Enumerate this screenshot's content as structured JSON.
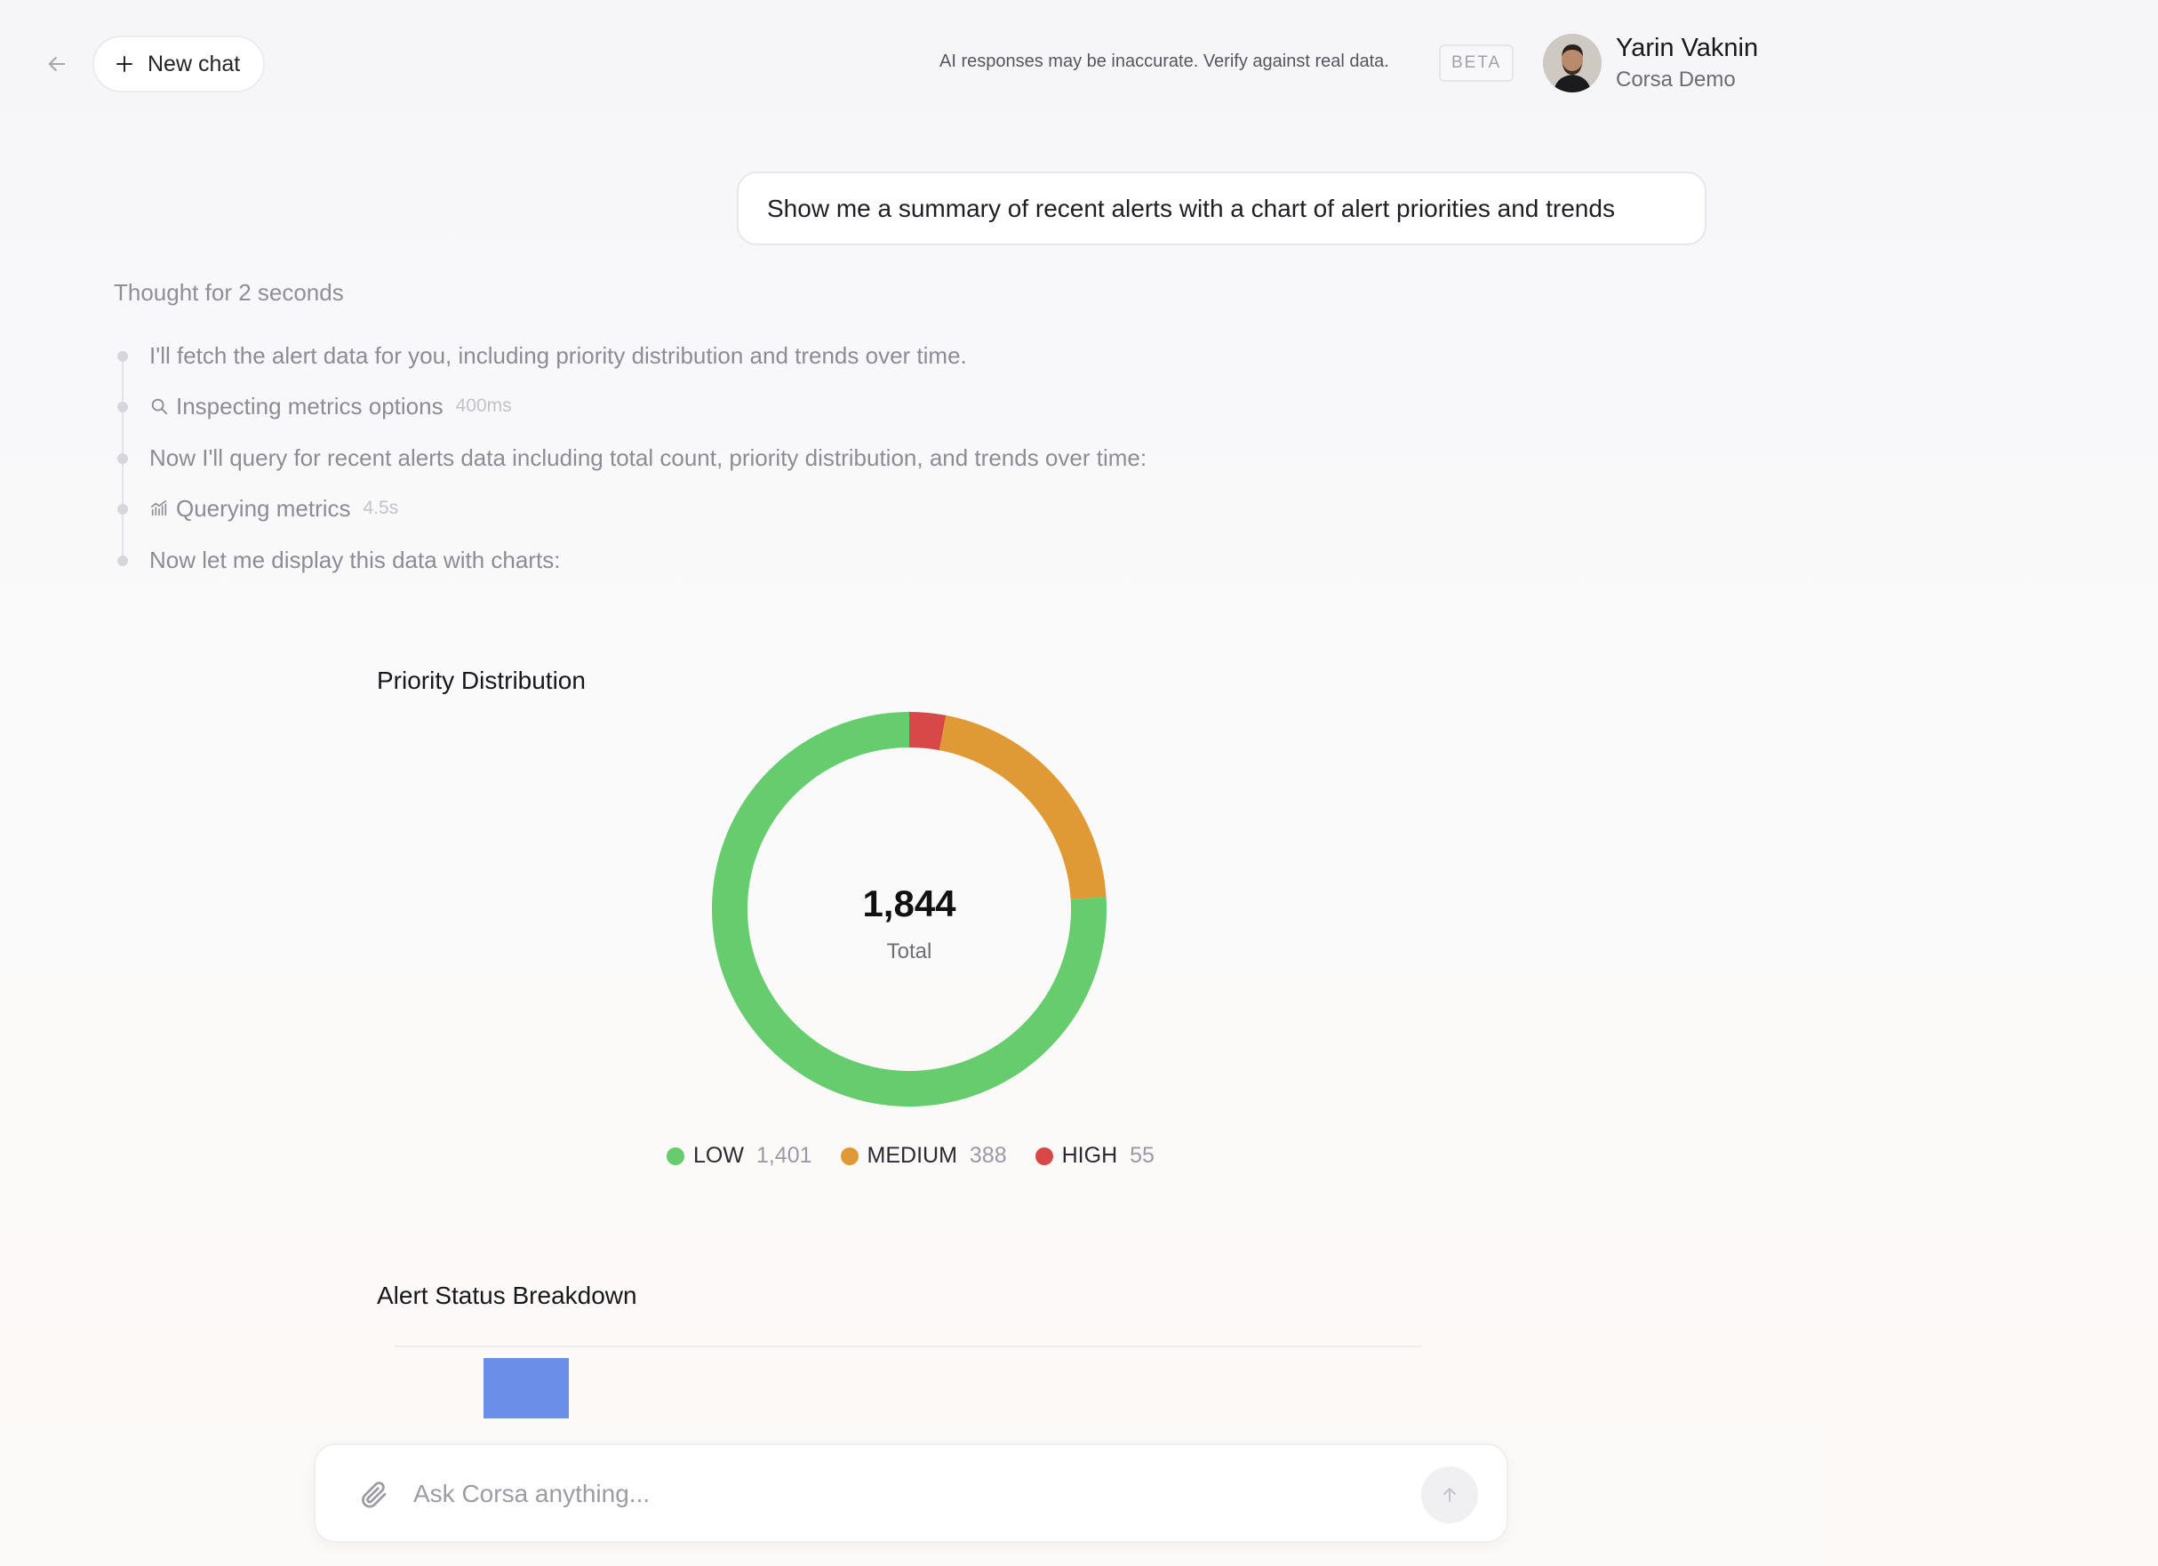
{
  "header": {
    "new_chat_label": "New chat",
    "disclaimer": "AI responses may be inaccurate. Verify against real data.",
    "beta_badge": "BETA",
    "user_name": "Yarin Vaknin",
    "user_org": "Corsa Demo"
  },
  "conversation": {
    "user_message": "Show me a summary of recent alerts with a chart of alert priorities and trends",
    "thought_label": "Thought for 2 seconds",
    "steps": [
      {
        "text": "I'll fetch the alert data for you, including priority distribution and trends over time.",
        "icon": "",
        "duration": ""
      },
      {
        "text": "Inspecting metrics options",
        "icon": "search-icon",
        "duration": "400ms"
      },
      {
        "text": "Now I'll query for recent alerts data including total count, priority distribution, and trends over time:",
        "icon": "",
        "duration": ""
      },
      {
        "text": "Querying metrics",
        "icon": "chart-icon",
        "duration": "4.5s"
      },
      {
        "text": "Now let me display this data with charts:",
        "icon": "",
        "duration": ""
      }
    ]
  },
  "charts": {
    "priority_title": "Priority Distribution",
    "total_value": "1,844",
    "total_label": "Total",
    "status_title": "Alert Status Breakdown"
  },
  "chart_data": [
    {
      "type": "pie",
      "title": "Priority Distribution",
      "center_value": 1844,
      "center_label": "Total",
      "legend_position": "bottom",
      "categories": [
        "LOW",
        "MEDIUM",
        "HIGH"
      ],
      "values": [
        1401,
        388,
        55
      ],
      "colors": [
        "#66cc6e",
        "#e09a35",
        "#d94848"
      ]
    },
    {
      "type": "bar",
      "title": "Alert Status Breakdown",
      "colors": [
        "#6b8ee9"
      ]
    }
  ],
  "composer": {
    "placeholder": "Ask Corsa anything..."
  }
}
